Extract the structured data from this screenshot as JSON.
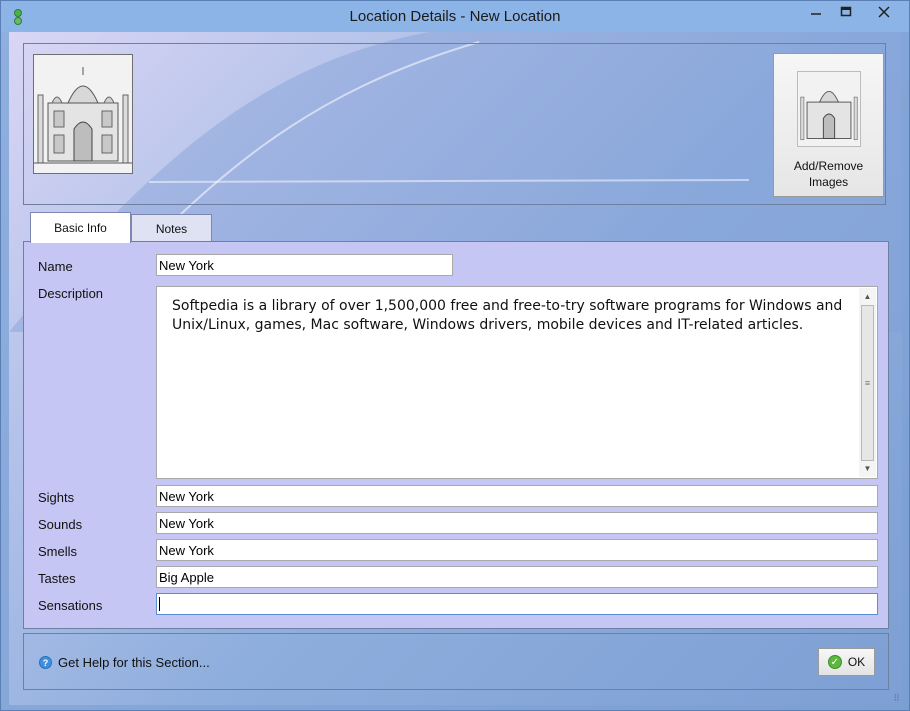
{
  "window": {
    "title": "Location Details - New Location",
    "minimize_glyph": "▭",
    "maximize_glyph": "□",
    "close_glyph": "✕"
  },
  "header": {
    "add_images_label": "Add/Remove Images"
  },
  "tabs": [
    {
      "label": "Basic Info",
      "active": true
    },
    {
      "label": "Notes",
      "active": false
    }
  ],
  "form": {
    "name_label": "Name",
    "name_value": "New York",
    "description_label": "Description",
    "description_value": "Softpedia is a library of over 1,500,000 free and free-to-try software programs for Windows and Unix/Linux, games, Mac software, Windows drivers, mobile devices and IT-related articles.",
    "sights_label": "Sights",
    "sights_value": "New York",
    "sounds_label": "Sounds",
    "sounds_value": "New York",
    "smells_label": "Smells",
    "smells_value": "New York",
    "tastes_label": "Tastes",
    "tastes_value": "Big Apple",
    "sensations_label": "Sensations",
    "sensations_value": ""
  },
  "footer": {
    "help_label": "Get Help for this Section...",
    "ok_label": "OK"
  },
  "colors": {
    "panel": "#c6c6f4",
    "titlebar": "#8db4e6"
  },
  "icons": [
    "app-icon",
    "help-icon",
    "ok-check-icon",
    "scroll-up-icon",
    "scroll-down-icon"
  ]
}
